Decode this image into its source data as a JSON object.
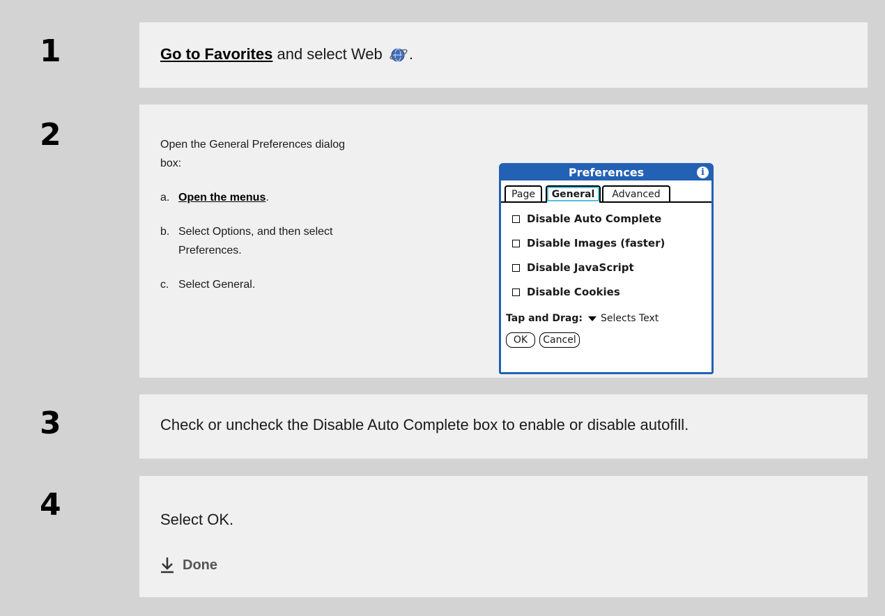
{
  "steps": [
    {
      "number": "1",
      "link": "Go to Favorites",
      "text": " and select Web",
      "icon": "web-globe-icon"
    },
    {
      "number": "2",
      "intro": "Open the General Preferences dialog box:",
      "items": [
        {
          "label": "a.",
          "link": "Open the menus",
          "tail": "."
        },
        {
          "label": "b.",
          "text": "Select Options, and then select Preferences."
        },
        {
          "label": "c.",
          "text": "Select General."
        }
      ]
    },
    {
      "number": "3",
      "text": "Check or uncheck the Disable Auto Complete box to enable or disable autofill."
    },
    {
      "number": "4",
      "text": "Select OK.",
      "done": "Done"
    }
  ],
  "dialog": {
    "title": "Preferences",
    "info_icon": "info-icon",
    "tabs": [
      "Page",
      "General",
      "Advanced"
    ],
    "active_tab": "General",
    "options": [
      {
        "label": "Disable Auto Complete",
        "checked": false
      },
      {
        "label": "Disable Images (faster)",
        "checked": false
      },
      {
        "label": "Disable JavaScript",
        "checked": false
      },
      {
        "label": "Disable Cookies",
        "checked": false
      }
    ],
    "tap_label": "Tap and Drag:",
    "tap_value": "Selects Text",
    "buttons": [
      "OK",
      "Cancel"
    ],
    "accent": "#2361b4"
  }
}
